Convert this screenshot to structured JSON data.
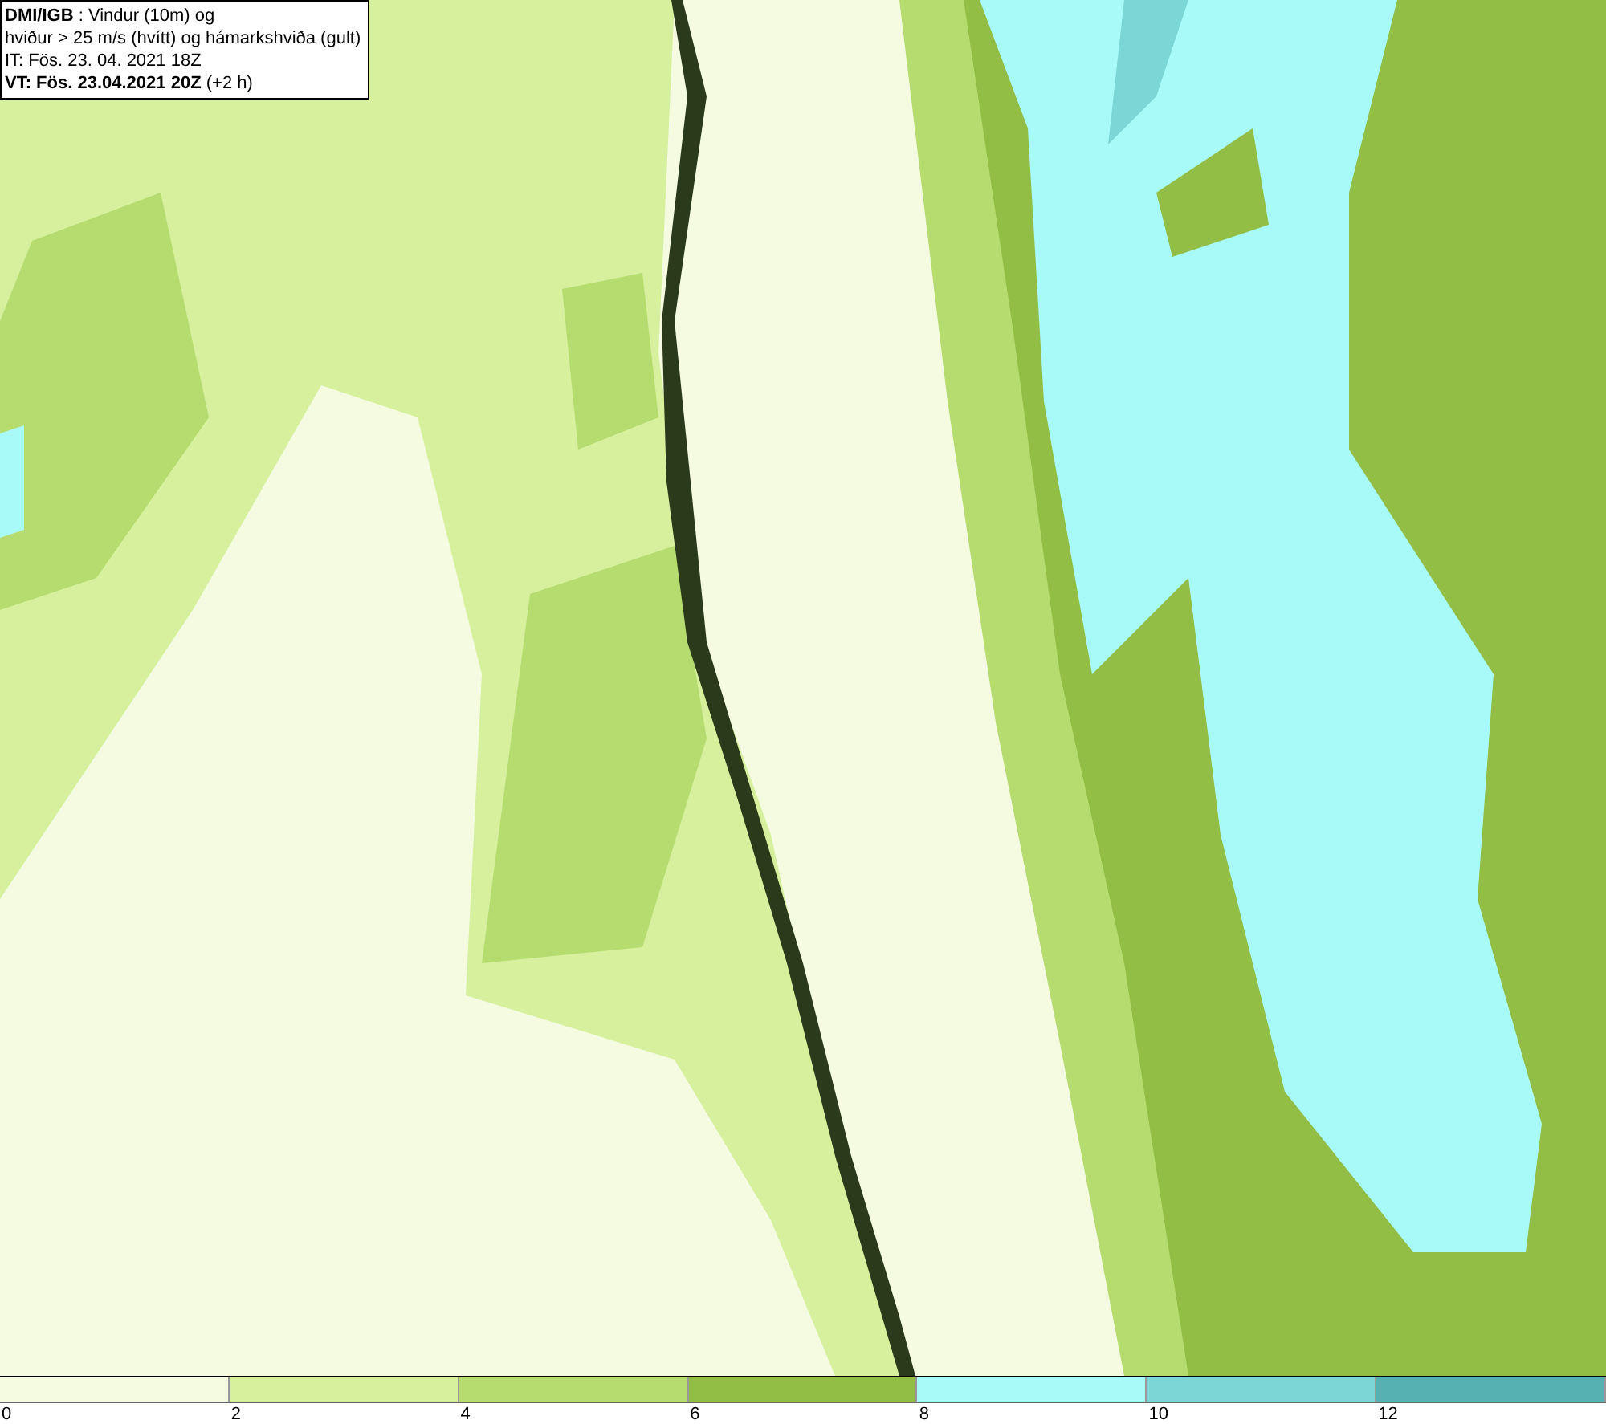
{
  "info_box": {
    "lines": [
      "**DMI/IGB** : Vindur (10m) og",
      "hviður > 25 m/s (hvítt) og hámarkshviða (gult)",
      "IT: Fös. 23. 04. 2021 18Z",
      "**VT: Fös. 23.04.2021 20Z** (+2 h)"
    ]
  },
  "legend": {
    "bins": [
      {
        "color": "#f4fbe0"
      },
      {
        "color": "#d6f09e"
      },
      {
        "color": "#b6dc70"
      },
      {
        "color": "#93be45"
      },
      {
        "color": "#a8faf8"
      },
      {
        "color": "#7dd6d6"
      },
      {
        "color": "#56b2b2"
      }
    ],
    "ticks": [
      "0",
      "2",
      "4",
      "6",
      "8",
      "10",
      "12"
    ]
  }
}
